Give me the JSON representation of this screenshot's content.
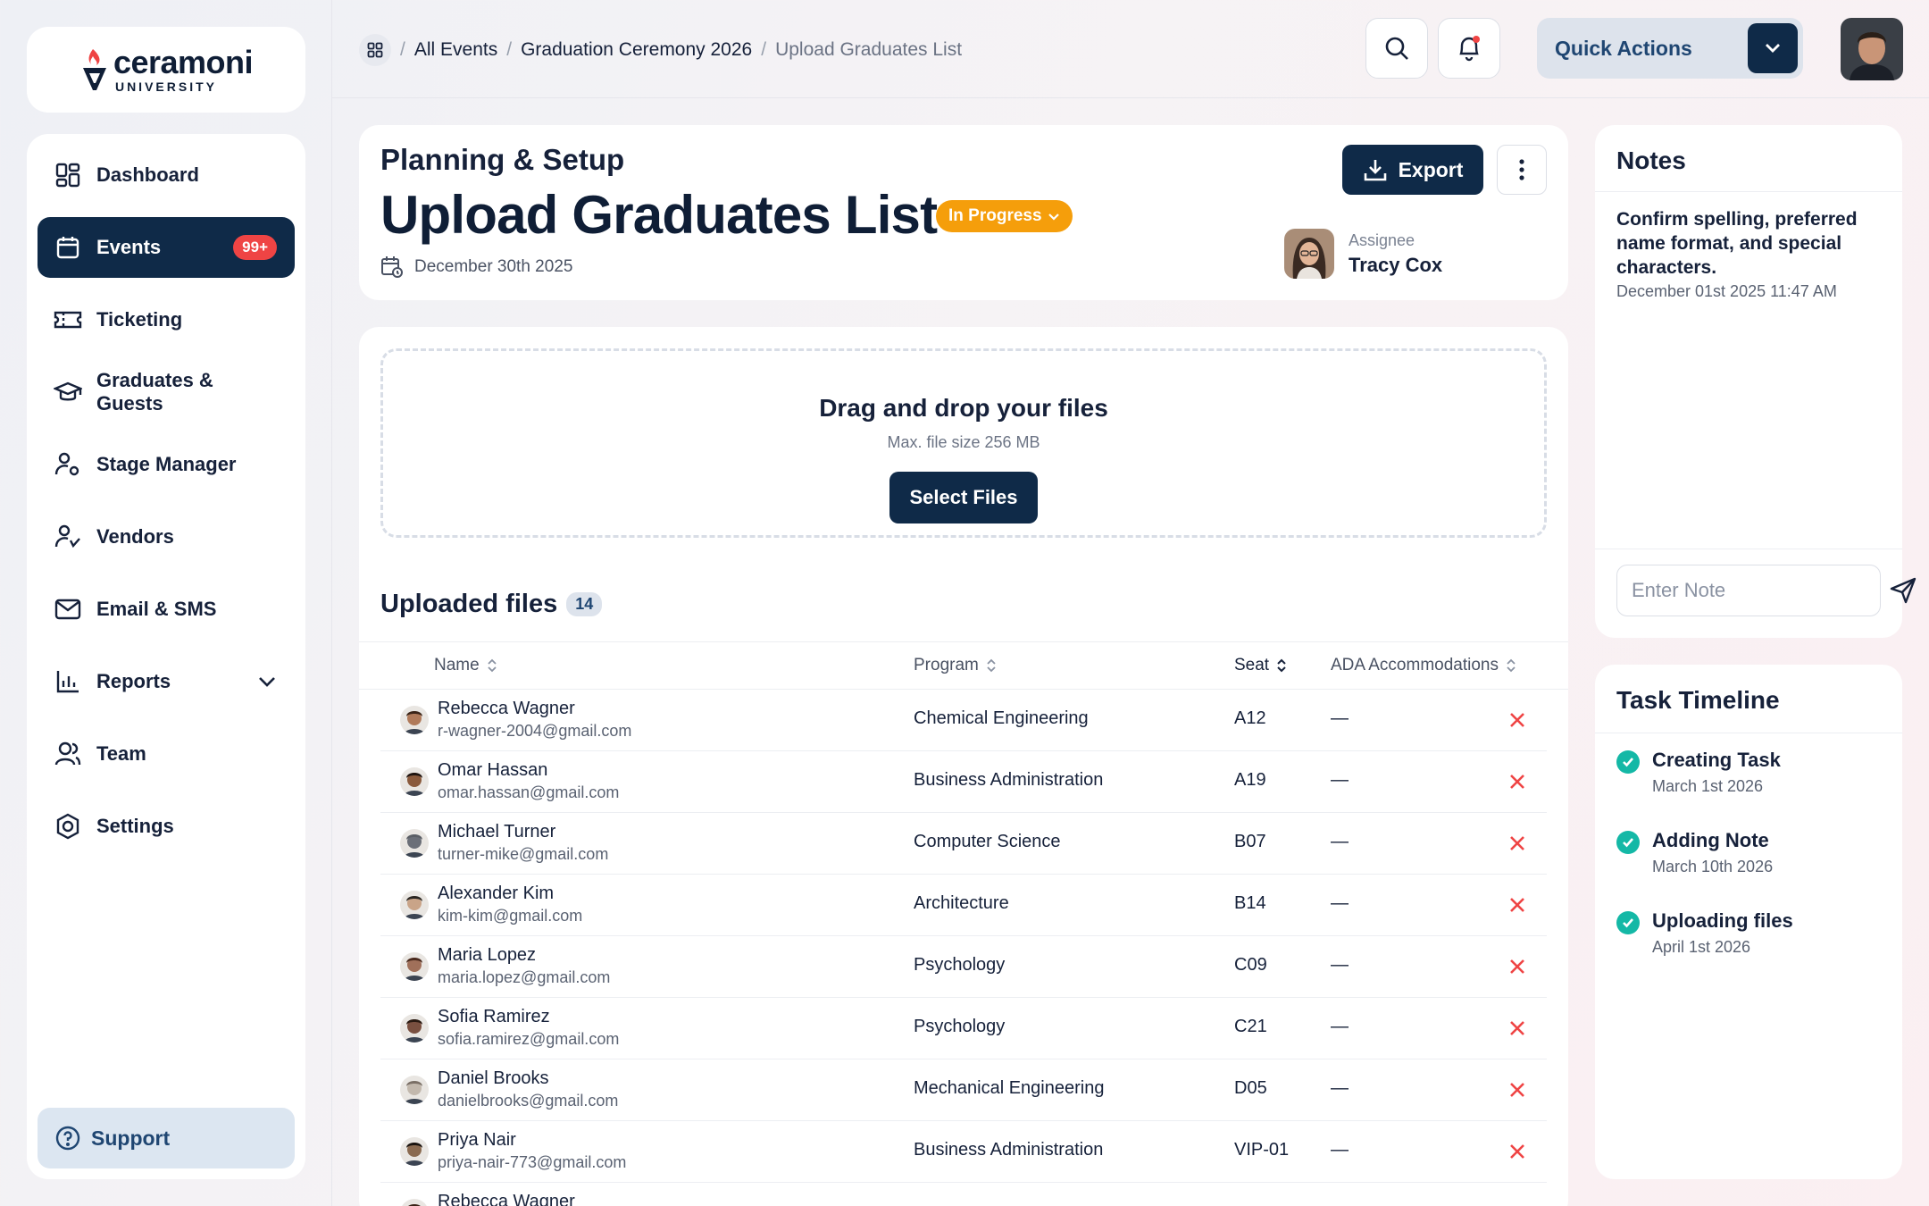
{
  "brand": {
    "name": "ceramoni",
    "sub": "UNIVERSITY"
  },
  "sidebar": {
    "items": [
      {
        "label": "Dashboard",
        "icon": "dashboard-icon"
      },
      {
        "label": "Events",
        "icon": "calendar-icon",
        "badge": "99+",
        "active": true
      },
      {
        "label": "Ticketing",
        "icon": "ticket-icon"
      },
      {
        "label": "Graduates & Guests",
        "icon": "graduation-cap-icon"
      },
      {
        "label": "Stage Manager",
        "icon": "user-settings-icon"
      },
      {
        "label": "Vendors",
        "icon": "vendor-icon"
      },
      {
        "label": "Email & SMS",
        "icon": "mail-icon"
      },
      {
        "label": "Reports",
        "icon": "bar-chart-icon",
        "expandable": true
      },
      {
        "label": "Team",
        "icon": "users-icon"
      },
      {
        "label": "Settings",
        "icon": "settings-icon"
      }
    ],
    "support_label": "Support"
  },
  "breadcrumb": {
    "items": [
      "All Events",
      "Graduation Ceremony 2026"
    ],
    "current": "Upload Graduates List"
  },
  "topbar": {
    "quick_actions": "Quick Actions"
  },
  "header": {
    "section": "Planning & Setup",
    "title": "Upload Graduates List",
    "status": "In Progress",
    "date": "December 30th 2025",
    "export_label": "Export",
    "assignee_label": "Assignee",
    "assignee_name": "Tracy Cox"
  },
  "upload": {
    "title": "Drag and drop your files",
    "subtitle": "Max. file size 256 MB",
    "button": "Select Files"
  },
  "files": {
    "title": "Uploaded files",
    "count": "14",
    "columns": {
      "name": "Name",
      "program": "Program",
      "seat": "Seat",
      "ada": "ADA Accommodations"
    },
    "rows": [
      {
        "name": "Rebecca Wagner",
        "email": "r-wagner-2004@gmail.com",
        "program": "Chemical Engineering",
        "seat": "A12",
        "ada": "—"
      },
      {
        "name": "Omar Hassan",
        "email": "omar.hassan@gmail.com",
        "program": "Business Administration",
        "seat": "A19",
        "ada": "—"
      },
      {
        "name": "Michael Turner",
        "email": "turner-mike@gmail.com",
        "program": "Computer Science",
        "seat": "B07",
        "ada": "—"
      },
      {
        "name": "Alexander Kim",
        "email": "kim-kim@gmail.com",
        "program": "Architecture",
        "seat": "B14",
        "ada": "—"
      },
      {
        "name": "Maria Lopez",
        "email": "maria.lopez@gmail.com",
        "program": "Psychology",
        "seat": "C09",
        "ada": "—"
      },
      {
        "name": "Sofia Ramirez",
        "email": "sofia.ramirez@gmail.com",
        "program": "Psychology",
        "seat": "C21",
        "ada": "—"
      },
      {
        "name": "Daniel Brooks",
        "email": "danielbrooks@gmail.com",
        "program": "Mechanical Engineering",
        "seat": "D05",
        "ada": "—"
      },
      {
        "name": "Priya Nair",
        "email": "priya-nair-773@gmail.com",
        "program": "Business Administration",
        "seat": "VIP-01",
        "ada": "—"
      },
      {
        "name": "Rebecca Wagner",
        "email": "",
        "program": "",
        "seat": "",
        "ada": ""
      }
    ]
  },
  "notes": {
    "title": "Notes",
    "text": "Confirm spelling, preferred name format, and special characters.",
    "date": "December 01st 2025 11:47 AM",
    "placeholder": "Enter Note"
  },
  "timeline": {
    "title": "Task Timeline",
    "items": [
      {
        "title": "Creating Task",
        "date": "March 1st 2026"
      },
      {
        "title": "Adding Note",
        "date": "March 10th 2026"
      },
      {
        "title": "Uploading files",
        "date": "April 1st 2026"
      }
    ]
  },
  "colors": {
    "navy": "#0f2a48",
    "status": "#f59e0b",
    "danger": "#ef4444",
    "success": "#14b8a6"
  }
}
